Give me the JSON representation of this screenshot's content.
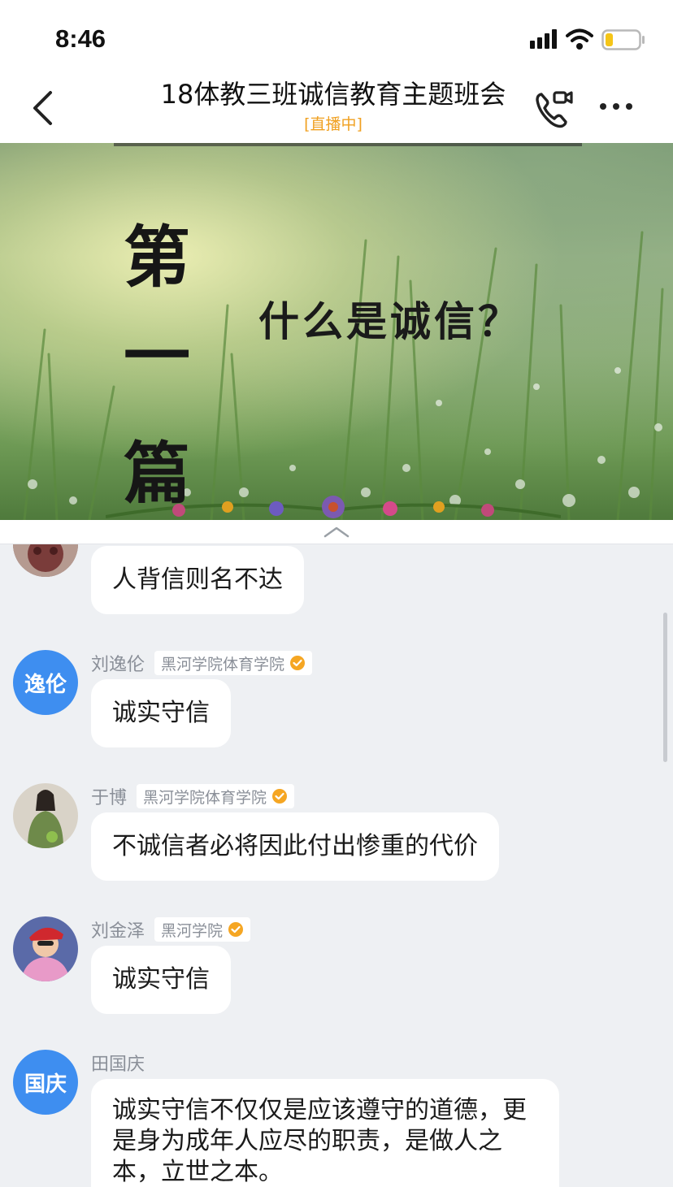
{
  "status_bar": {
    "time": "8:46"
  },
  "header": {
    "title": "18体教三班诚信教育主题班会",
    "subtitle": "[直播中]"
  },
  "video": {
    "slide_chars": [
      "第",
      "一",
      "篇"
    ],
    "slide_question": "什么是诚信？"
  },
  "messages": [
    {
      "text": "人背信则名不达"
    },
    {
      "avatar_text": "逸伦",
      "name": "刘逸伦",
      "tag": "黑河学院体育学院",
      "text": "诚实守信"
    },
    {
      "name": "于博",
      "tag": "黑河学院体育学院",
      "text": "不诚信者必将因此付出惨重的代价"
    },
    {
      "name": "刘金泽",
      "tag": "黑河学院",
      "text": "诚实守信"
    },
    {
      "avatar_text": "国庆",
      "name": "田国庆",
      "text": "诚实守信不仅仅是应该遵守的道德，更是身为成年人应尽的职责，是做人之本，立世之本。"
    }
  ],
  "colors": {
    "accent": "#3e8ef0",
    "live_status": "#f0a020",
    "verified": "#f5a623"
  }
}
